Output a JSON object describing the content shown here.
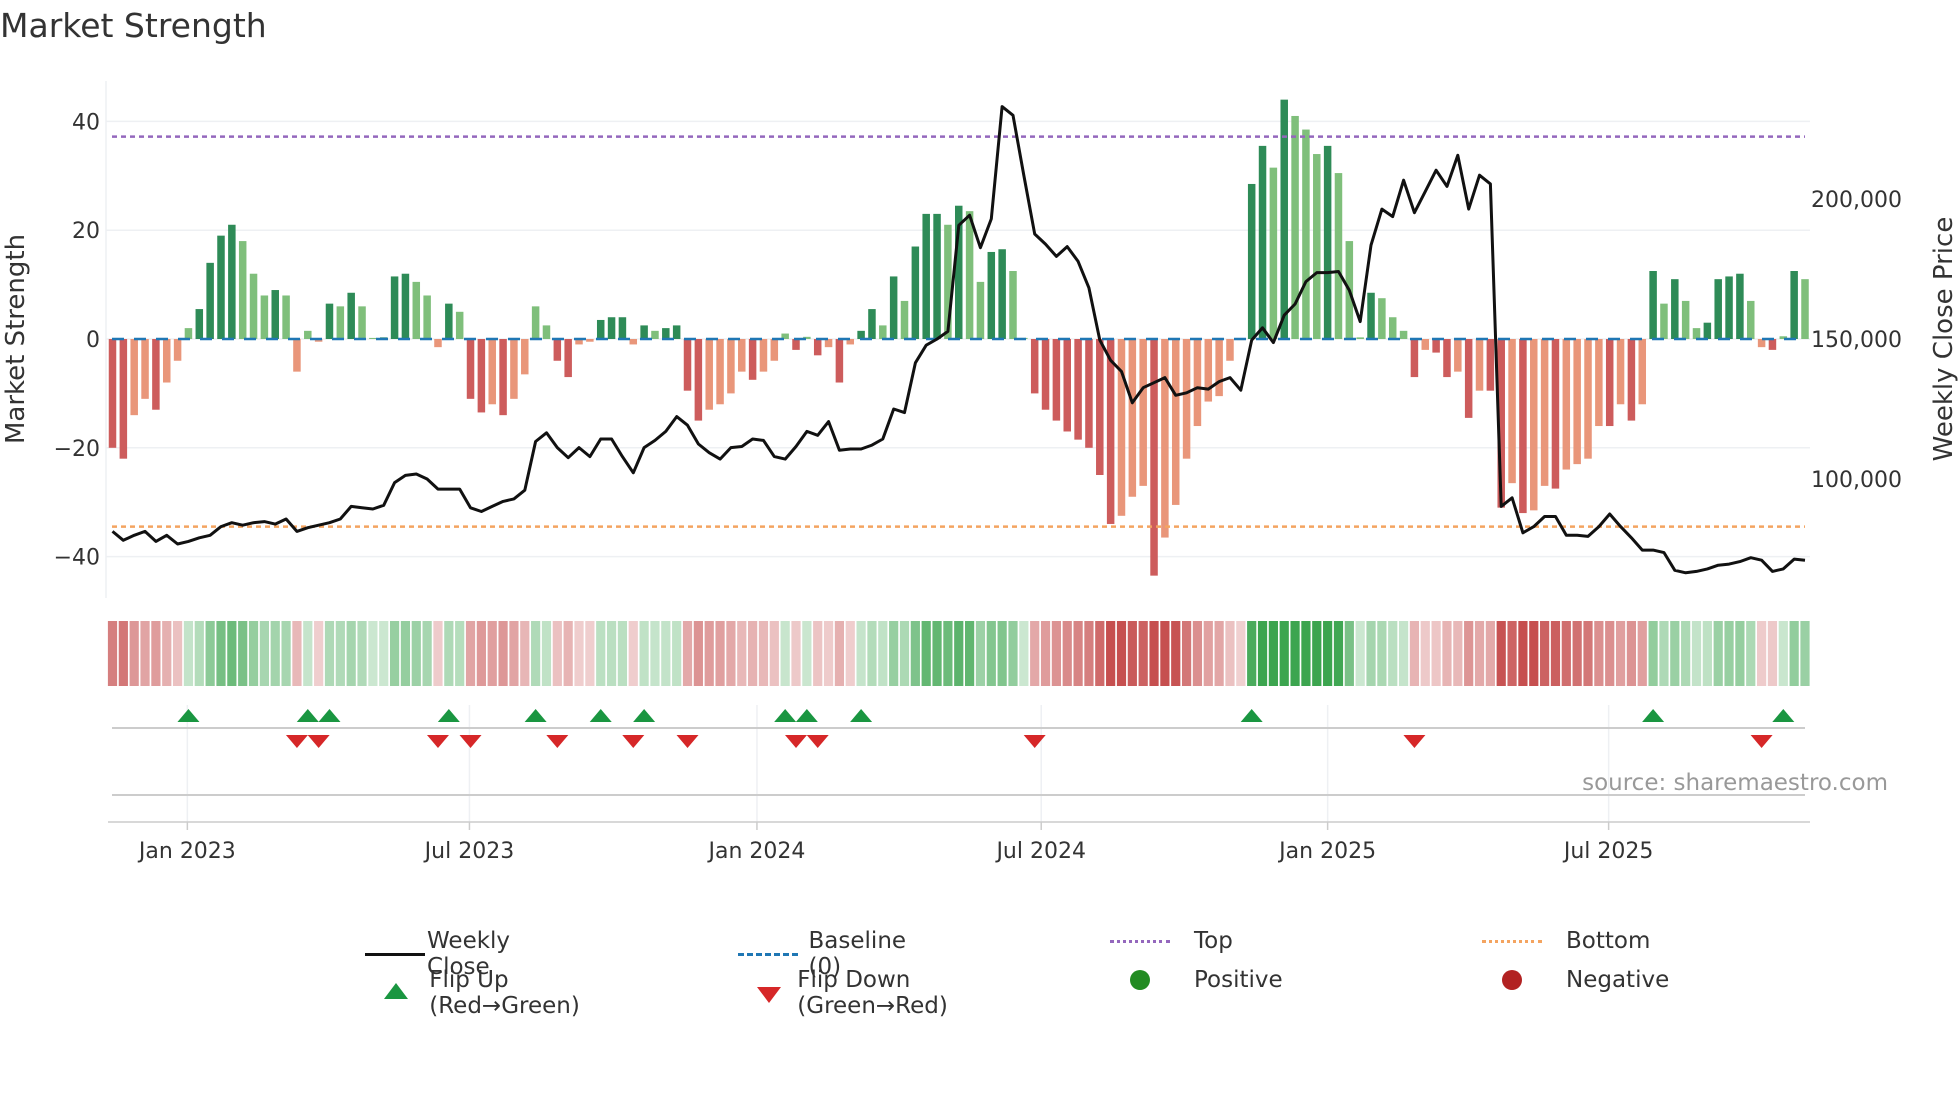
{
  "chart_data": {
    "type": "bar",
    "title": "Market Strength",
    "ylabel": "Market Strength",
    "y2label": "Weekly Close Price",
    "ylim": [
      -47,
      47
    ],
    "y2lim": [
      60000,
      243000
    ],
    "y_ticks": [
      {
        "value": 40,
        "label": "40"
      },
      {
        "value": 20,
        "label": "20"
      },
      {
        "value": 0,
        "label": "0"
      },
      {
        "value": -20,
        "label": "−20"
      },
      {
        "value": -40,
        "label": "−40"
      }
    ],
    "y2_ticks": [
      {
        "value": 200000,
        "label": "200,000"
      },
      {
        "value": 150000,
        "label": "150,000"
      },
      {
        "value": 100000,
        "label": "100,000"
      }
    ],
    "x_ticks": [
      {
        "x": 6.9,
        "label": "Jan 2023"
      },
      {
        "x": 32.9,
        "label": "Jul 2023"
      },
      {
        "x": 59.4,
        "label": "Jan 2024"
      },
      {
        "x": 85.6,
        "label": "Jul 2024"
      },
      {
        "x": 112.0,
        "label": "Jan 2025"
      },
      {
        "x": 137.9,
        "label": "Jul 2025"
      }
    ],
    "top_level": 37.2,
    "bottom_level": -34.5,
    "strength": [
      -20,
      -22,
      -14,
      -11,
      -13,
      -8,
      -4,
      2,
      5.5,
      14,
      19,
      21,
      18,
      12,
      8,
      9,
      8,
      -6,
      1.5,
      -0.5,
      6.5,
      6,
      8.5,
      6,
      0.2,
      0.3,
      11.5,
      12,
      10.5,
      8,
      -1.5,
      6.5,
      5,
      -11,
      -13.5,
      -12,
      -14,
      -11,
      -6.5,
      6,
      2.5,
      -4,
      -7,
      -1,
      -0.5,
      3.5,
      4,
      4,
      -1,
      2.5,
      1.5,
      2,
      2.5,
      -9.5,
      -15,
      -13,
      -12,
      -10,
      -6,
      -7.5,
      -6,
      -4,
      1,
      -2,
      0.4,
      -3,
      -1.5,
      -8,
      -1,
      1.5,
      5.5,
      2.5,
      11.5,
      7,
      17,
      23,
      23,
      21,
      24.5,
      23.5,
      10.5,
      16,
      16.5,
      12.5,
      0.2,
      -10,
      -13,
      -15,
      -17,
      -18.5,
      -20,
      -25,
      -34,
      -32.5,
      -29,
      -27,
      -43.5,
      -36.5,
      -30.5,
      -22,
      -16,
      -11.5,
      -10.5,
      -4,
      -0.2,
      28.5,
      35.5,
      31.5,
      44,
      41,
      38.5,
      34,
      35.5,
      30.5,
      18,
      0.3,
      8.5,
      7.5,
      4,
      1.5,
      -7,
      -2,
      -2.5,
      -7,
      -6,
      -14.5,
      -9.5,
      -9.5,
      -31,
      -26.5,
      -32,
      -31.5,
      -27,
      -27.5,
      -24,
      -23,
      -22,
      -16,
      -16,
      -12,
      -15,
      -12,
      12.5,
      6.5,
      11,
      7,
      2,
      3,
      11,
      11.5,
      12,
      7,
      -1.5,
      -2,
      0.5,
      12.5,
      11
    ],
    "close_k": [
      81.3,
      78.1,
      79.9,
      81.3,
      77.7,
      79.9,
      76.8,
      77.7,
      79.0,
      79.9,
      83.0,
      84.4,
      83.5,
      84.4,
      84.8,
      83.9,
      85.7,
      81.3,
      82.6,
      83.5,
      84.4,
      85.7,
      90.2,
      89.7,
      89.3,
      90.6,
      98.7,
      101.3,
      101.8,
      100.0,
      96.4,
      96.4,
      96.4,
      89.7,
      88.4,
      90.2,
      92.0,
      92.9,
      96.0,
      113.4,
      116.5,
      111.2,
      107.6,
      111.2,
      108.0,
      114.3,
      114.3,
      108.0,
      102.2,
      111.2,
      113.8,
      117.0,
      122.3,
      119.2,
      112.5,
      109.4,
      107.1,
      111.2,
      111.6,
      114.3,
      113.8,
      108.0,
      107.1,
      111.6,
      117.0,
      115.6,
      120.5,
      110.3,
      110.7,
      110.7,
      112.1,
      114.3,
      125.0,
      123.7,
      141.5,
      147.8,
      150.0,
      152.7,
      190.6,
      194.2,
      182.6,
      192.9,
      233.0,
      229.9,
      208.5,
      187.5,
      183.9,
      179.5,
      183.0,
      177.7,
      168.3,
      149.6,
      142.4,
      138.4,
      127.2,
      132.6,
      134.4,
      136.2,
      129.9,
      130.8,
      132.6,
      132.1,
      134.8,
      136.2,
      131.7,
      149.6,
      154.0,
      148.7,
      158.5,
      162.5,
      170.5,
      173.7,
      173.7,
      174.1,
      167.4,
      156.2,
      183.5,
      196.4,
      193.7,
      206.7,
      195.1,
      202.7,
      210.3,
      204.5,
      215.6,
      196.4,
      208.5,
      205.4,
      90.2,
      93.3,
      80.8,
      83.0,
      86.6,
      86.6,
      79.9,
      79.9,
      79.5,
      83.0,
      87.5,
      83.0,
      79.0,
      74.6,
      74.6,
      73.7,
      67.4,
      66.5,
      67.0,
      67.9,
      69.2,
      69.6,
      70.5,
      71.9,
      71.0,
      67.0,
      67.9,
      71.4,
      71.0
    ],
    "colors": {
      "pos_strong": "#2e8b57",
      "pos_weak": "#7fbf7b",
      "neg_strong": "#cd5c5c",
      "neg_weak": "#e9967a",
      "baseline": "#1f77b4",
      "top": "#9467bd",
      "bottom": "#f4a460",
      "flip_up": "#1a9641",
      "flip_down": "#d62728",
      "positive": "#228b22",
      "negative": "#b22222"
    },
    "legend": [
      {
        "key": "close",
        "label": "Weekly Close"
      },
      {
        "key": "baseline",
        "label": "Baseline (0)"
      },
      {
        "key": "top",
        "label": "Top"
      },
      {
        "key": "bottom",
        "label": "Bottom"
      },
      {
        "key": "flip_up",
        "label": "Flip Up (Red→Green)"
      },
      {
        "key": "flip_down",
        "label": "Flip Down (Green→Red)"
      },
      {
        "key": "positive",
        "label": "Positive"
      },
      {
        "key": "negative",
        "label": "Negative"
      }
    ],
    "legend_position": "bottom"
  },
  "source": "source: sharemaestro.com"
}
